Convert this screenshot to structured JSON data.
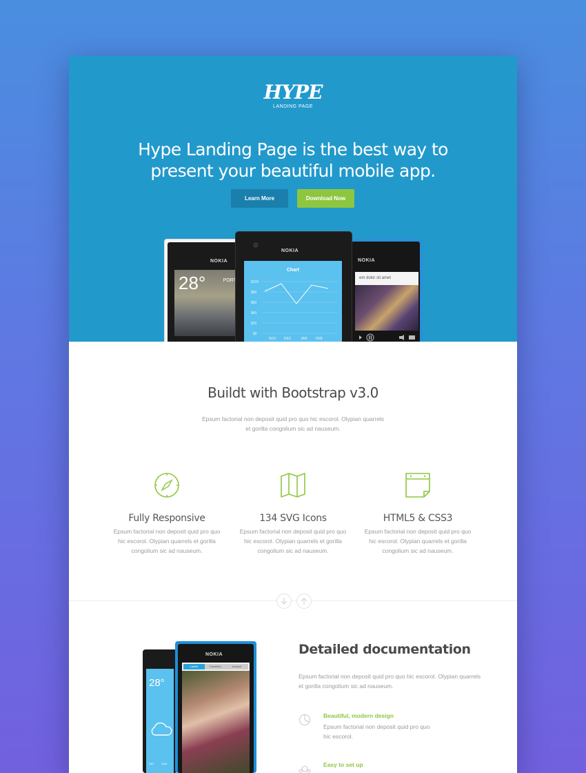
{
  "logo": {
    "text": "HYPE",
    "subtitle": "LANDING PAGE"
  },
  "hero": {
    "title": "Hype Landing Page is the best way to present your beautiful mobile app.",
    "learn_more": "Learn More",
    "download": "Download Now"
  },
  "phones": {
    "left": {
      "brand": "NOKIA",
      "temperature": "28°",
      "location": "PORT"
    },
    "middle": {
      "brand": "NOKIA",
      "chart_title": "Chart",
      "y_ticks": [
        "$100",
        "$80",
        "$60",
        "$40",
        "$20",
        "$0"
      ],
      "x_ticks": [
        "NOV",
        "DEC",
        "JAN",
        "FEB"
      ]
    },
    "right": {
      "brand": "NOKIA",
      "caption": "em dolor sit amet"
    }
  },
  "features_section": {
    "title": "Buildt with Bootstrap v3.0",
    "description": "Epsum factorial non deposit quid pro quo hic escorol. Olypian quarrels et gorilla congolium sic ad nauseum.",
    "features": [
      {
        "icon": "compass-icon",
        "title": "Fully Responsive",
        "description": "Epsum factorial non deposit quid pro quo hic escorol. Olypian quarrels et gorilla congolium sic ad nauseum."
      },
      {
        "icon": "map-icon",
        "title": "134 SVG Icons",
        "description": "Epsum factorial non deposit quid pro quo hic escorol. Olypian quarrels et gorilla congolium sic ad nauseum."
      },
      {
        "icon": "calendar-icon",
        "title": "HTML5 & CSS3",
        "description": "Epsum factorial non deposit quid pro quo hic escorol. Olypian quarrels et gorilla congolium sic ad nauseum."
      }
    ]
  },
  "docs_section": {
    "title": "Detailed documentation",
    "description": "Epsum factorial non deposit quid pro quo hic escorol. Olypian quarrels et gorilla congolium sic ad nauseum.",
    "items": [
      {
        "icon": "pie-chart-icon",
        "title": "Beautiful, modern design",
        "description": "Epsum factorial non deposit quid pro quo hic escorol."
      },
      {
        "icon": "gears-icon",
        "title": "Easy to set up",
        "description": ""
      }
    ],
    "phone": {
      "brand": "NOKIA",
      "temperature": "28°",
      "tabs": [
        "Latest",
        "Favorites",
        "Archive"
      ],
      "days": [
        "SAT",
        "SUN"
      ]
    }
  },
  "colors": {
    "accent": "#8ec63f",
    "hero_bg": "#2299cb",
    "learn_btn": "#1a7fad",
    "background_top": "#4a8ee0",
    "background_bottom": "#7260df"
  }
}
